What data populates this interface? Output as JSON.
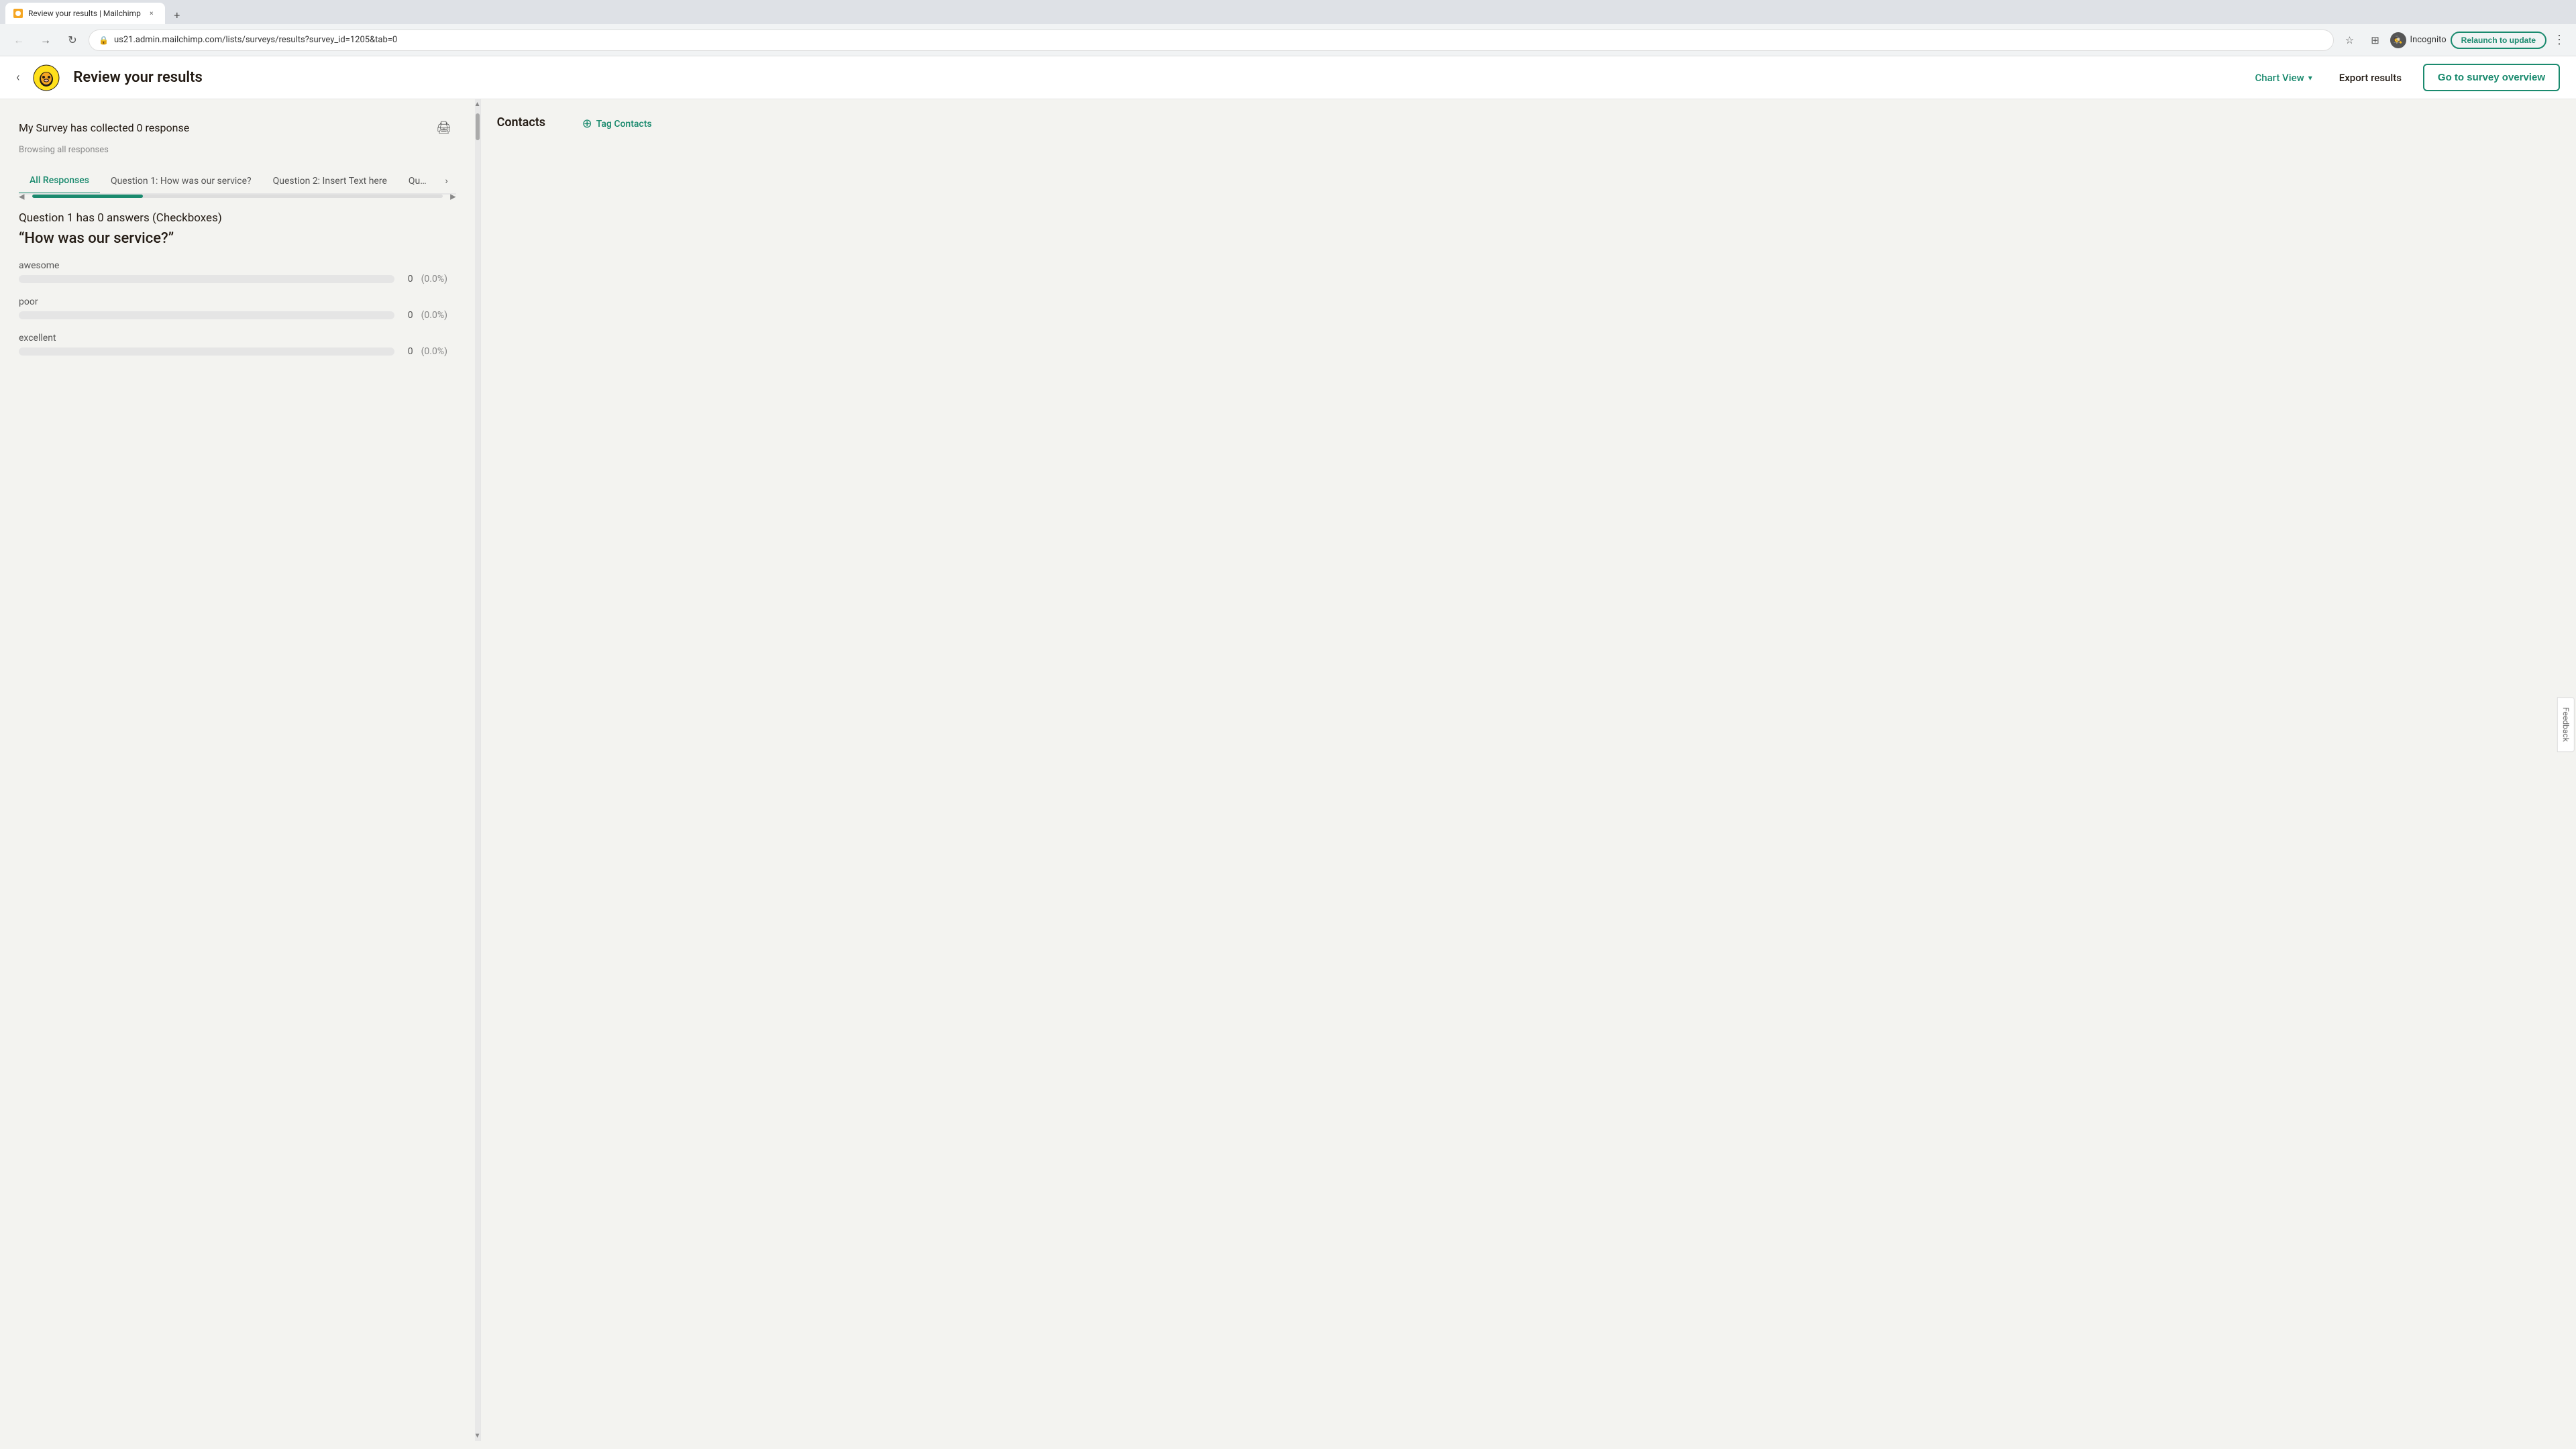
{
  "browser": {
    "tab_favicon_color": "#f5a623",
    "tab_title": "Review your results | Mailchimp",
    "tab_close_icon": "×",
    "new_tab_icon": "+",
    "nav_back_icon": "←",
    "nav_forward_icon": "→",
    "nav_reload_icon": "↻",
    "address_url": "us21.admin.mailchimp.com/lists/surveys/results?survey_id=1205&tab=0",
    "bookmark_icon": "☆",
    "extensions_icon": "⊞",
    "incognito_label": "Incognito",
    "relaunch_label": "Relaunch to update",
    "kebab_icon": "⋮"
  },
  "header": {
    "back_icon": "‹",
    "page_title": "Review your results",
    "chart_view_label": "Chart View",
    "chart_view_chevron": "▾",
    "export_label": "Export results",
    "go_survey_label": "Go to survey overview"
  },
  "content": {
    "survey_response_text": "My Survey has collected 0 response",
    "print_icon": "🖨",
    "browsing_text": "Browsing all responses",
    "tabs": [
      {
        "label": "All Responses",
        "active": true
      },
      {
        "label": "Question 1: How was our service?",
        "active": false
      },
      {
        "label": "Question 2: Insert Text here",
        "active": false
      },
      {
        "label": "Qu…",
        "active": false
      }
    ],
    "tabs_scroll_icon": "›",
    "question_header": "Question 1 has 0 answers (Checkboxes)",
    "question_quote": "“How was our service?”",
    "answers": [
      {
        "label": "awesome",
        "count": "0",
        "pct": "(0.0%)",
        "fill_pct": 0
      },
      {
        "label": "poor",
        "count": "0",
        "pct": "(0.0%)",
        "fill_pct": 0
      },
      {
        "label": "excellent",
        "count": "0",
        "pct": "(0.0%)",
        "fill_pct": 0
      }
    ]
  },
  "sidebar": {
    "title": "Contacts",
    "tag_contacts_label": "Tag Contacts",
    "plus_icon": "⊕"
  },
  "feedback": {
    "label": "Feedback"
  }
}
